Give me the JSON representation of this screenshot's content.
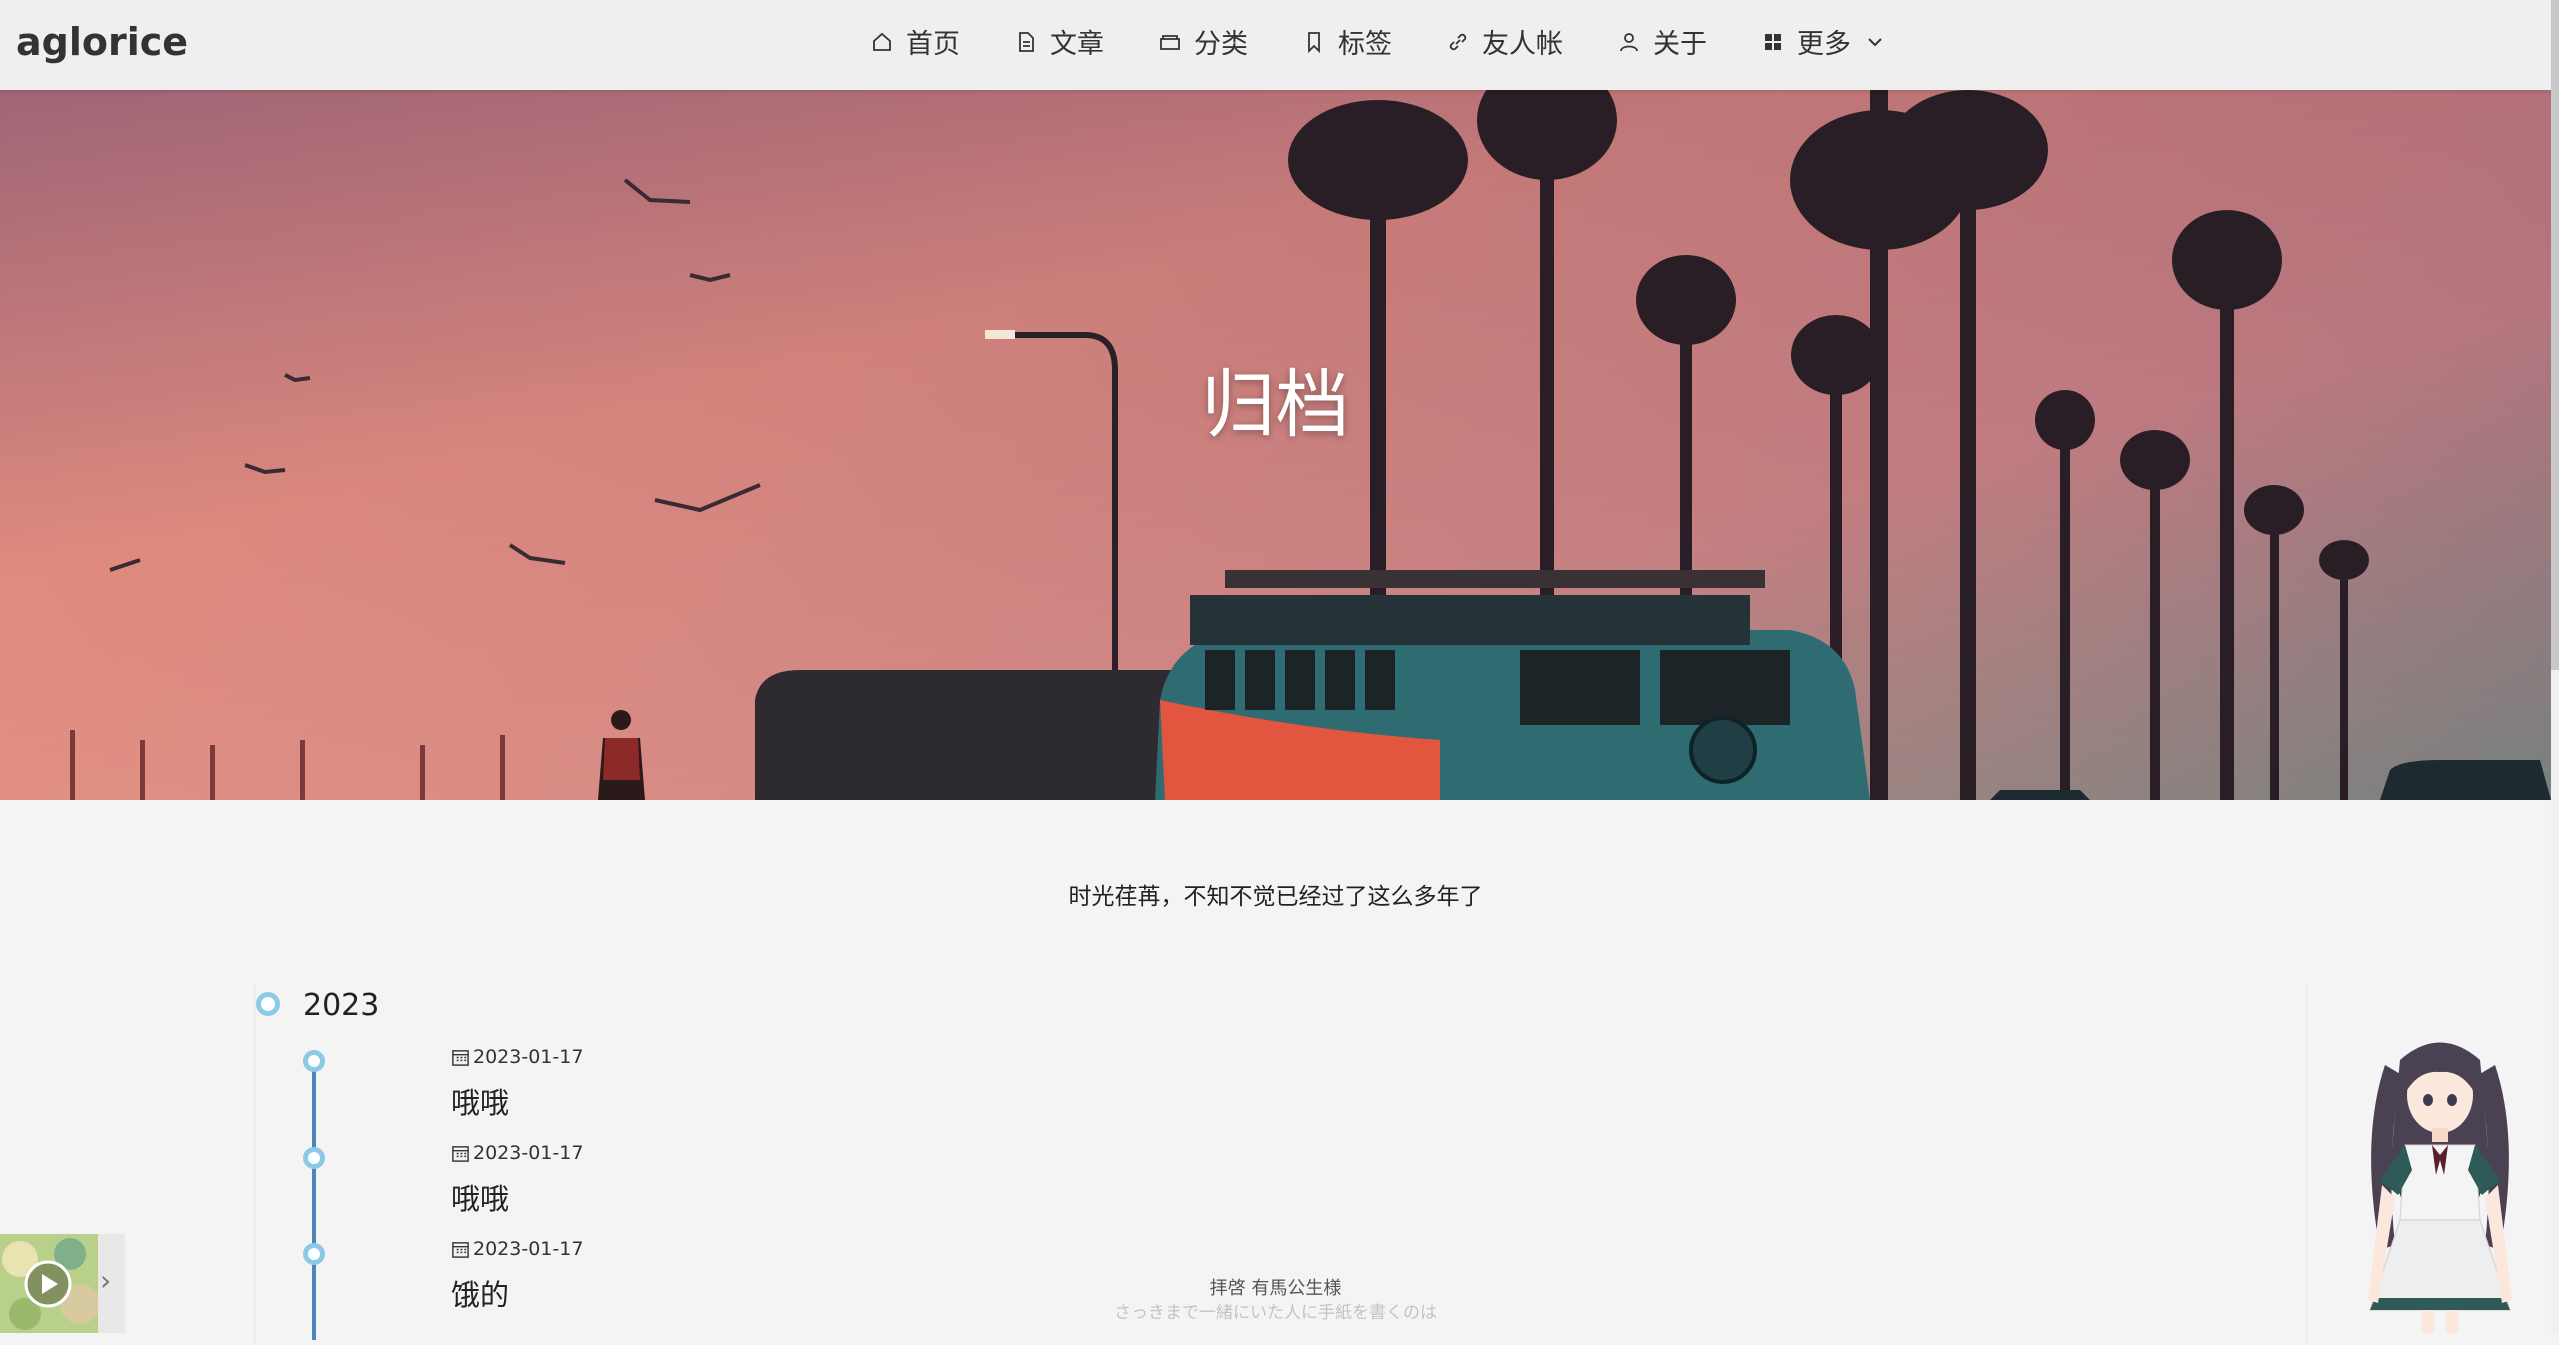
{
  "site": {
    "brand": "aglorice"
  },
  "nav": {
    "items": [
      {
        "label": "首页",
        "icon": "home-icon"
      },
      {
        "label": "文章",
        "icon": "document-icon"
      },
      {
        "label": "分类",
        "icon": "folder-icon"
      },
      {
        "label": "标签",
        "icon": "bookmark-icon"
      },
      {
        "label": "友人帐",
        "icon": "link-icon"
      },
      {
        "label": "关于",
        "icon": "user-icon"
      },
      {
        "label": "更多",
        "icon": "grid-icon"
      }
    ]
  },
  "hero": {
    "title": "归档"
  },
  "page": {
    "subtitle": "时光荏苒，不知不觉已经过了这么多年了"
  },
  "archive": {
    "year": "2023",
    "posts": [
      {
        "date": "2023-01-17",
        "title": "哦哦"
      },
      {
        "date": "2023-01-17",
        "title": "哦哦"
      },
      {
        "date": "2023-01-17",
        "title": "饿的"
      }
    ]
  },
  "footer": {
    "line1": "拝啓 有馬公生様",
    "line2": "さっきまで一緒にいた人に手紙を書くのは"
  },
  "colors": {
    "timeline_line": "#4a86ba",
    "timeline_dot": "#8cc9e6",
    "background": "#f4f4f4"
  }
}
